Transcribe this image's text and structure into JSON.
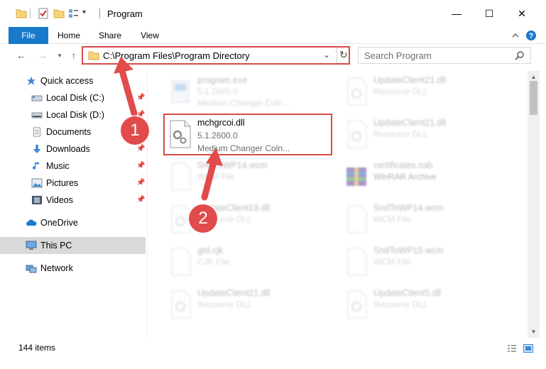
{
  "window": {
    "title": "Program",
    "minimize_glyph": "—",
    "maximize_glyph": "☐",
    "close_glyph": "✕"
  },
  "ribbon": {
    "tabs": [
      {
        "label": "File"
      },
      {
        "label": "Home"
      },
      {
        "label": "Share"
      },
      {
        "label": "View"
      }
    ]
  },
  "address": {
    "path": "C:\\Program Files\\Program Directory",
    "search_placeholder": "Search Program"
  },
  "sidebar": {
    "items": [
      {
        "label": "Quick access",
        "icon": "star-icon"
      },
      {
        "label": "Local Disk (C:)",
        "icon": "drive-icon",
        "pinned": true
      },
      {
        "label": "Local Disk (D:)",
        "icon": "drive-icon",
        "pinned": true
      },
      {
        "label": "Documents",
        "icon": "documents-icon",
        "pinned": true
      },
      {
        "label": "Downloads",
        "icon": "downloads-icon",
        "pinned": true
      },
      {
        "label": "Music",
        "icon": "music-icon",
        "pinned": true
      },
      {
        "label": "Pictures",
        "icon": "pictures-icon",
        "pinned": true
      },
      {
        "label": "Videos",
        "icon": "videos-icon",
        "pinned": true
      },
      {
        "label": "OneDrive",
        "icon": "onedrive-icon"
      },
      {
        "label": "This PC",
        "icon": "computer-icon",
        "selected": true
      },
      {
        "label": "Network",
        "icon": "network-icon"
      }
    ]
  },
  "files": [
    {
      "name": "program.exe",
      "line1": "5.1.2600.0",
      "line2": "Medium Changer Coln...",
      "icon": "exe-icon"
    },
    {
      "name": "UpdateClient21.dll",
      "line1": "Resource DLL",
      "line2": "",
      "icon": "dll-icon"
    },
    {
      "name": "mchgrcoi.dll",
      "line1": "5.1.2600.0",
      "line2": "Medium Changer Coln...",
      "icon": "dll-gear-icon",
      "highlighted": true
    },
    {
      "name": "UpdateClient21.dll",
      "line1": "Resource DLL",
      "line2": "",
      "icon": "dll-icon"
    },
    {
      "name": "SndToWP14.wcm",
      "line1": "WCM File",
      "line2": "",
      "icon": "file-icon"
    },
    {
      "name": "certificates.cab",
      "line1": "WinRAR Archive",
      "line2": "",
      "icon": "archive-icon"
    },
    {
      "name": "UpdateClient19.dll",
      "line1": "Resource DLL",
      "line2": "",
      "icon": "dll-icon"
    },
    {
      "name": "SndToWP14.wcm",
      "line1": "WCM File",
      "line2": "",
      "icon": "file-icon"
    },
    {
      "name": "gtd.cjk",
      "line1": "CJK File",
      "line2": "",
      "icon": "file-icon"
    },
    {
      "name": "SndToWP15.wcm",
      "line1": "WCM File",
      "line2": "",
      "icon": "file-icon"
    },
    {
      "name": "UpdateClient21.dll",
      "line1": "Resource DLL",
      "line2": "",
      "icon": "dll-icon"
    },
    {
      "name": "UpdateClient5.dll",
      "line1": "Resource DLL",
      "line2": "",
      "icon": "dll-icon"
    }
  ],
  "status": {
    "items_count": "144 items"
  },
  "annotations": {
    "step1": "1",
    "step2": "2",
    "color": "#e14b4b"
  }
}
